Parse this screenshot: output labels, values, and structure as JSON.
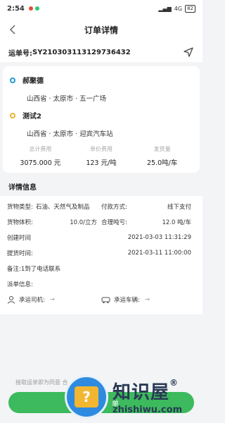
{
  "status_bar": {
    "time": "2:54",
    "signal": "4G",
    "battery": "82"
  },
  "nav": {
    "title": "订单详情"
  },
  "order": {
    "label": "运单号: ",
    "number": "SY210303113129736432"
  },
  "route": {
    "from": {
      "name": "郝聚德",
      "address": "山西省 · 太原市 · 五一广场"
    },
    "to": {
      "name": "测试2",
      "address": "山西省 · 太原市 · 迎宾汽车站"
    }
  },
  "stats": [
    {
      "label": "总计费用",
      "value": "3075.000 元"
    },
    {
      "label": "单价费用",
      "value": "123 元/吨"
    },
    {
      "label": "发货量",
      "value": "25.0吨/车"
    }
  ],
  "details": {
    "title": "详情信息",
    "cargo_type_label": "货物类型:",
    "cargo_type_value": "石油、天然气及制品",
    "payment_label": "付款方式:",
    "payment_value": "线下支付",
    "volume_label": "货物体积:",
    "volume_value": "10.0/立方",
    "loss_label": "合理吨亏:",
    "loss_value": "12.0 吨/车",
    "created_label": "创建时间",
    "created_value": "2021-03-03 11:31:29",
    "pickup_label": "提货时间:",
    "pickup_value": "2021-03-11 11:00:00",
    "remark": "备注:1到了电话联系",
    "waybill_label": "派单信息:",
    "driver_label": "承运司机:",
    "vehicle_label": "承运车辆:",
    "arrow": "→"
  },
  "footer": {
    "hint": "接取运单即为同意 合",
    "button": "单"
  },
  "watermark": {
    "cn": "知识屋",
    "reg": "®",
    "en": "zhishiwu.com",
    "q": "?"
  }
}
